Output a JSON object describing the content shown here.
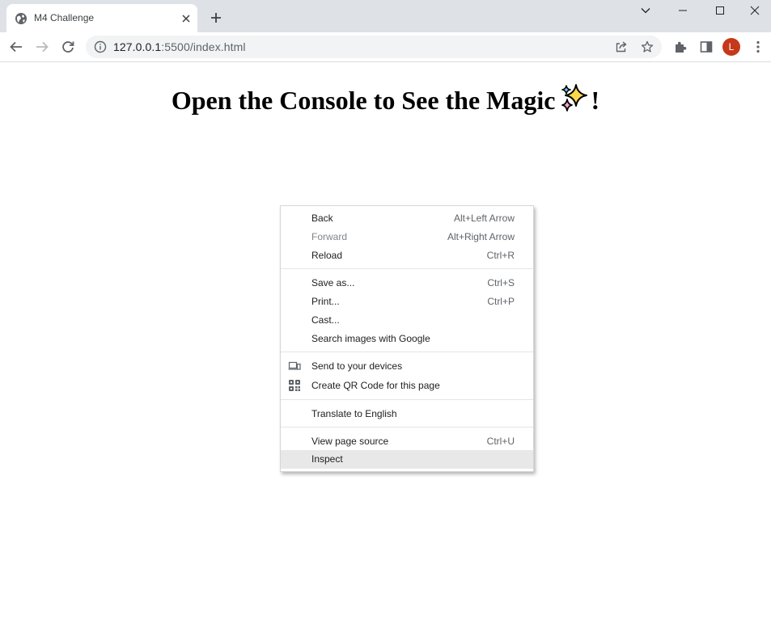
{
  "browser": {
    "tab": {
      "title": "M4 Challenge"
    },
    "address": {
      "host": "127.0.0.1",
      "rest": ":5500/index.html"
    },
    "profile_initial": "L"
  },
  "page": {
    "heading_before": "Open the Console to See the Magic",
    "heading_after": "!"
  },
  "context_menu": {
    "items": [
      {
        "label": "Back",
        "shortcut": "Alt+Left Arrow"
      },
      {
        "label": "Forward",
        "shortcut": "Alt+Right Arrow"
      },
      {
        "label": "Reload",
        "shortcut": "Ctrl+R"
      },
      {
        "label": "Save as...",
        "shortcut": "Ctrl+S"
      },
      {
        "label": "Print...",
        "shortcut": "Ctrl+P"
      },
      {
        "label": "Cast...",
        "shortcut": ""
      },
      {
        "label": "Search images with Google",
        "shortcut": ""
      },
      {
        "label": "Send to your devices",
        "shortcut": "",
        "icon": "devices-icon"
      },
      {
        "label": "Create QR Code for this page",
        "shortcut": "",
        "icon": "qr-code-icon"
      },
      {
        "label": "Translate to English",
        "shortcut": ""
      },
      {
        "label": "View page source",
        "shortcut": "Ctrl+U"
      },
      {
        "label": "Inspect",
        "shortcut": ""
      }
    ]
  }
}
